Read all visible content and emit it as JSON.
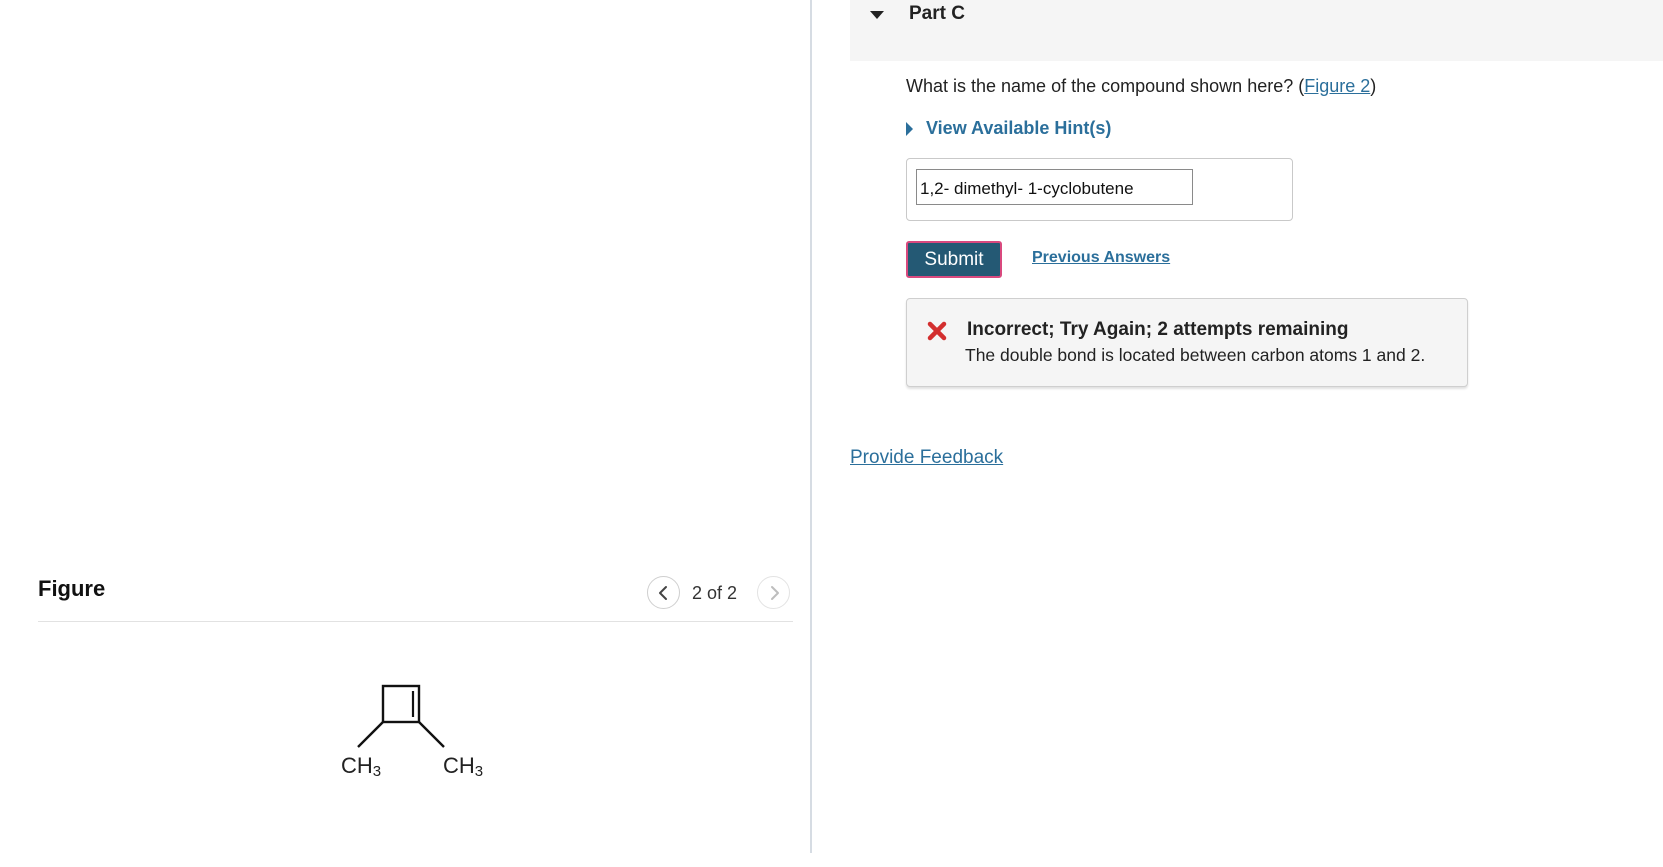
{
  "figure": {
    "title": "Figure",
    "counter": "2 of 2",
    "molecule_labels": [
      "CH3",
      "CH3"
    ]
  },
  "part": {
    "title": "Part C",
    "question_prefix": "What is the name of the compound shown here? (",
    "question_link": "Figure 2",
    "question_suffix": ")",
    "hint_label": "View Available Hint(s)",
    "answer_value": "1,2- dimethyl- 1-cyclobutene",
    "submit_label": "Submit",
    "previous_answers_label": "Previous Answers",
    "feedback_title": "Incorrect; Try Again; 2 attempts remaining",
    "feedback_text": "The double bond is located between carbon atoms 1 and 2."
  },
  "footer": {
    "provide_feedback_label": "Provide Feedback"
  },
  "colors": {
    "link": "#2b6f9b",
    "submit_bg": "#245974",
    "submit_border": "#d9497e",
    "error_icon": "#d32f2f"
  }
}
